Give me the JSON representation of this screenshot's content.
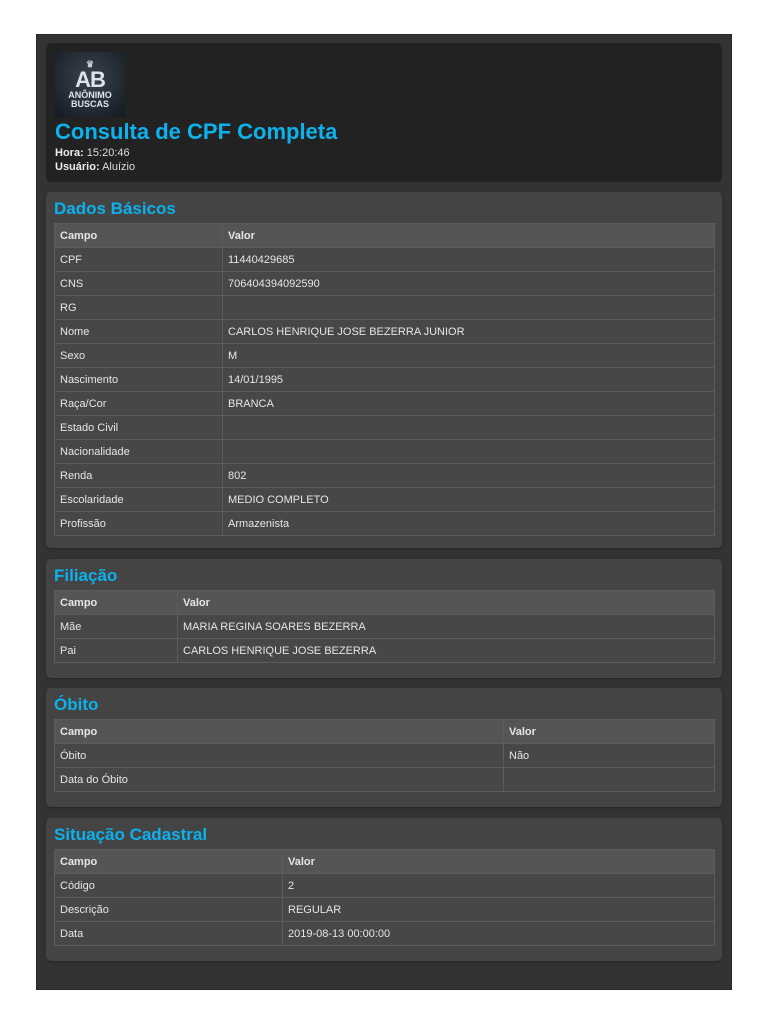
{
  "header": {
    "logo_text": [
      "AB",
      "ANÔNIMO",
      "BUSCAS"
    ],
    "title": "Consulta de CPF Completa",
    "hora_label": "Hora:",
    "hora": "15:20:46",
    "usuario_label": "Usuário:",
    "usuario": "Aluízio"
  },
  "sections": [
    {
      "title": "Dados Básicos",
      "headers": [
        "Campo",
        "Valor"
      ],
      "rows": [
        [
          "CPF",
          "11440429685"
        ],
        [
          "CNS",
          "706404394092590"
        ],
        [
          "RG",
          ""
        ],
        [
          "Nome",
          "CARLOS HENRIQUE JOSE BEZERRA JUNIOR"
        ],
        [
          "Sexo",
          "M"
        ],
        [
          "Nascimento",
          "14/01/1995"
        ],
        [
          "Raça/Cor",
          "BRANCA"
        ],
        [
          "Estado Civil",
          ""
        ],
        [
          "Nacionalidade",
          ""
        ],
        [
          "Renda",
          "802"
        ],
        [
          "Escolaridade",
          "MEDIO COMPLETO"
        ],
        [
          "Profissão",
          "Armazenista"
        ]
      ]
    },
    {
      "title": "Filiação",
      "headers": [
        "Campo",
        "Valor"
      ],
      "rows": [
        [
          "Mãe",
          "MARIA REGINA SOARES BEZERRA"
        ],
        [
          "Pai",
          "CARLOS HENRIQUE JOSE BEZERRA"
        ]
      ]
    },
    {
      "title": "Óbito",
      "headers": [
        "Campo",
        "Valor"
      ],
      "rows": [
        [
          "Óbito",
          "Não"
        ],
        [
          "Data do Óbito",
          ""
        ]
      ]
    },
    {
      "title": "Situação Cadastral",
      "headers": [
        "Campo",
        "Valor"
      ],
      "rows": [
        [
          "Código",
          "2"
        ],
        [
          "Descrição",
          "REGULAR"
        ],
        [
          "Data",
          "2019-08-13 00:00:00"
        ]
      ]
    }
  ]
}
